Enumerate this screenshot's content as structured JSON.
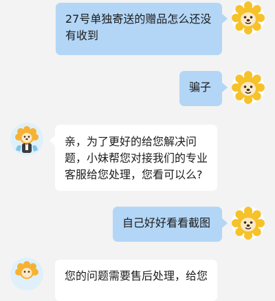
{
  "messages": [
    {
      "side": "out",
      "text": "27号单独寄送的赠品怎么还没有收到"
    },
    {
      "side": "out",
      "text": "骗子"
    },
    {
      "side": "in",
      "text": "亲，为了更好的给您解决问题，小妹帮您对接我们的专业客服给您处理，您看可以么?"
    },
    {
      "side": "out",
      "text": "自己好好看看截图"
    },
    {
      "side": "in",
      "text": "您的问题需要售后处理，给您"
    }
  ],
  "avatars": {
    "user": "lion-mascot-icon",
    "agent": "lion-mascot-agent-icon"
  },
  "colors": {
    "background": "#f3f3f3",
    "outgoing_bubble": "#b3d6f6",
    "incoming_bubble": "#ffffff",
    "lion_mane": "#f6c22a",
    "lion_face": "#fbe8c6"
  }
}
